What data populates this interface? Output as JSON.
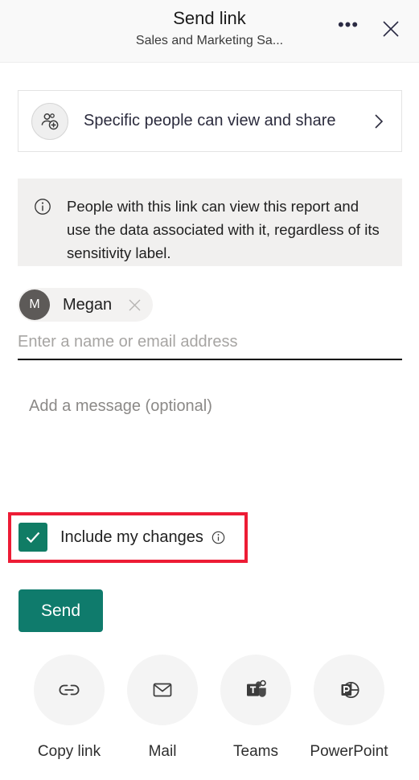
{
  "dialog": {
    "title": "Send link",
    "subtitle": "Sales and Marketing Sa...",
    "more_label": "•••",
    "more_icon": "ellipsis-icon",
    "close_icon": "close-icon"
  },
  "permission": {
    "icon": "people-add-icon",
    "label": "Specific people can view and share",
    "chevron_icon": "chevron-right-icon"
  },
  "info": {
    "icon": "info-circle-icon",
    "text": "People with this link can view this report and use the data associated with it, regardless of its sensitivity label."
  },
  "recipients": {
    "chips": [
      {
        "initial": "M",
        "name": "Megan",
        "remove_icon": "close-icon"
      }
    ],
    "input_value": "",
    "input_placeholder": "Enter a name or email address"
  },
  "message": {
    "value": "",
    "placeholder": "Add a message (optional)"
  },
  "include_changes": {
    "label": "Include my changes",
    "checked": true,
    "check_icon": "checkmark-icon",
    "info_icon": "info-circle-icon",
    "highlight_color": "#ed1c35",
    "accent_color": "#107c65"
  },
  "send": {
    "label": "Send",
    "color": "#0f7b6c"
  },
  "actions": [
    {
      "label": "Copy link",
      "icon": "link-icon"
    },
    {
      "label": "Mail",
      "icon": "mail-icon"
    },
    {
      "label": "Teams",
      "icon": "teams-icon"
    },
    {
      "label": "PowerPoint",
      "icon": "powerpoint-icon"
    }
  ]
}
